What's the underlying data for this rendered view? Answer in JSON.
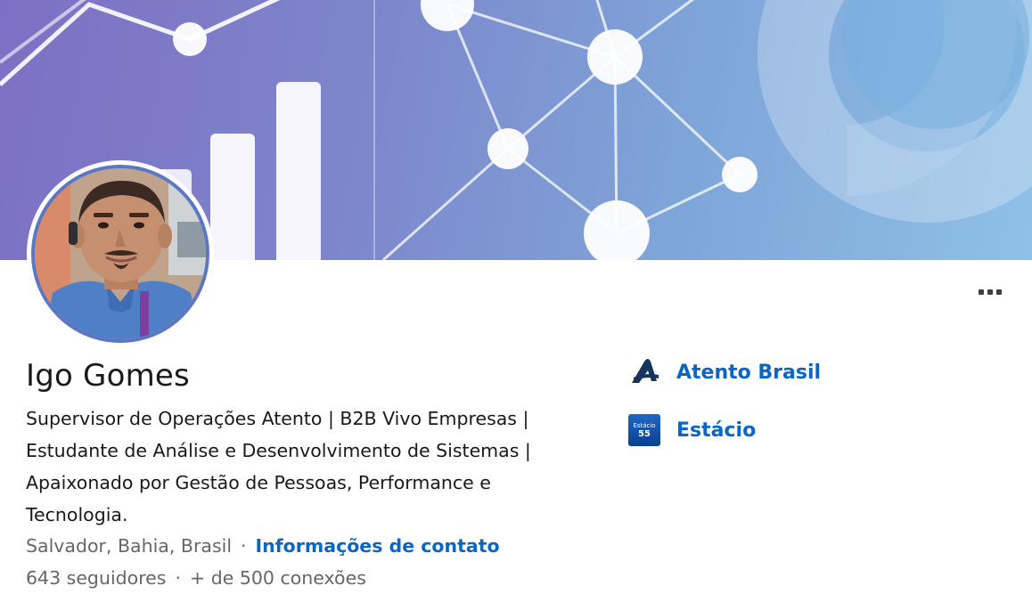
{
  "profile": {
    "name": "Igo Gomes",
    "headline": "Supervisor de Operações Atento | B2B Vivo Empresas | Estudante de Análise e Desenvolvimento de Sistemas | Apaixonado por Gestão de Pessoas, Performance e Tecnologia.",
    "location": "Salvador, Bahia, Brasil",
    "separator": "·",
    "contact_link": "Informações de contato",
    "followers": "643 seguidores",
    "connections": "+ de 500 conexões"
  },
  "organizations": [
    {
      "name": "Atento Brasil",
      "icon": "atento-logo"
    },
    {
      "name": "Estácio",
      "icon": "estacio-logo",
      "logo_text": "Estácio",
      "logo_number": "55"
    }
  ],
  "actions": {
    "more_icon": "more-horizontal-icon"
  },
  "colors": {
    "link": "#0a66c2",
    "text_primary": "#191919",
    "text_secondary": "#666666",
    "banner_start": "#7e6fc4",
    "banner_end": "#8fc0e6"
  }
}
